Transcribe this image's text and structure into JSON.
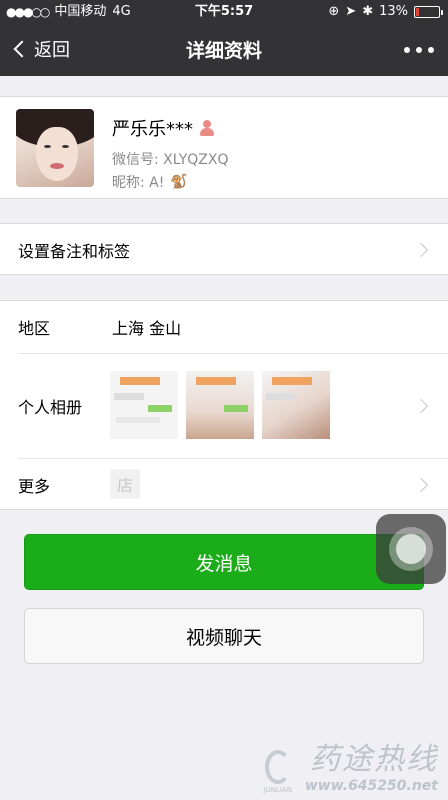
{
  "status_bar": {
    "signal_dots": "●●●○○",
    "carrier": "中国移动",
    "network": "4G",
    "time": "下午5:57",
    "battery": "13%",
    "battery_level": 0.13,
    "icons": [
      "orientation-lock-icon",
      "location-icon",
      "bluetooth-icon"
    ]
  },
  "nav": {
    "back_label": "返回",
    "title": "详细资料",
    "more_icon": "more-dots-icon"
  },
  "profile": {
    "name": "严乐乐***",
    "gender_icon": "female-icon",
    "wechat_id_label": "微信号:",
    "wechat_id": "XLYQZXQ",
    "nickname_label": "昵称:",
    "nickname": "A!",
    "nickname_emoji": "🐒"
  },
  "remark": {
    "label": "设置备注和标签"
  },
  "info": {
    "region_label": "地区",
    "region_value": "上海 金山",
    "album_label": "个人相册",
    "more_label": "更多",
    "store_glyph": "店"
  },
  "actions": {
    "send_message": "发消息",
    "video_chat": "视频聊天"
  },
  "watermark": {
    "logo_text": "JUNLIAN",
    "cn_text": "药途热线",
    "url": "www.645250.net"
  },
  "colors": {
    "nav_bg": "#333336",
    "primary_green": "#1aad19",
    "page_bg": "#efeff4"
  }
}
